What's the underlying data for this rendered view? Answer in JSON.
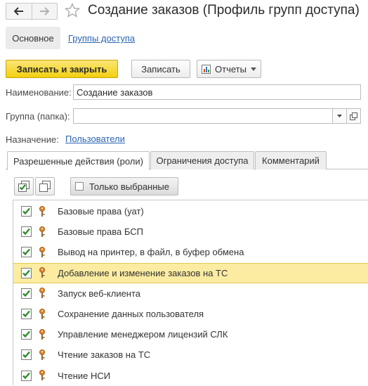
{
  "window": {
    "title": "Создание заказов (Профиль групп доступа)"
  },
  "sections": {
    "main": "Основное",
    "access_groups": "Группы доступа"
  },
  "toolbar": {
    "save_close": "Записать и закрыть",
    "save": "Записать",
    "reports": "Отчеты"
  },
  "form": {
    "name_label": "Наименование:",
    "name_value": "Создание заказов",
    "group_label": "Группа (папка):",
    "group_value": "",
    "purpose_label": "Назначение:",
    "purpose_value": "Пользователи"
  },
  "tabs": [
    {
      "label": "Разрешенные действия (роли)",
      "active": true
    },
    {
      "label": "Ограничения доступа",
      "active": false
    },
    {
      "label": "Комментарий",
      "active": false
    }
  ],
  "table_toolbar": {
    "only_selected": "Только выбранные",
    "only_selected_checked": false
  },
  "roles": [
    {
      "name": "Базовые права (уат)",
      "checked": true,
      "selected": false
    },
    {
      "name": "Базовые права БСП",
      "checked": true,
      "selected": false
    },
    {
      "name": "Вывод на принтер, в файл, в буфер обмена",
      "checked": true,
      "selected": false
    },
    {
      "name": "Добавление и изменение заказов на ТС",
      "checked": true,
      "selected": true
    },
    {
      "name": "Запуск веб-клиента",
      "checked": true,
      "selected": false
    },
    {
      "name": "Сохранение данных пользователя",
      "checked": true,
      "selected": false
    },
    {
      "name": "Управление менеджером лицензий СЛК",
      "checked": true,
      "selected": false
    },
    {
      "name": "Чтение заказов на ТС",
      "checked": true,
      "selected": false
    },
    {
      "name": "Чтение НСИ",
      "checked": true,
      "selected": false
    }
  ],
  "colors": {
    "primary_button": "#f3cf10",
    "link": "#2b64b3",
    "selected_row": "#fbeca2",
    "checkmark": "#2e8b2e",
    "key_icon": "#d9822b"
  }
}
